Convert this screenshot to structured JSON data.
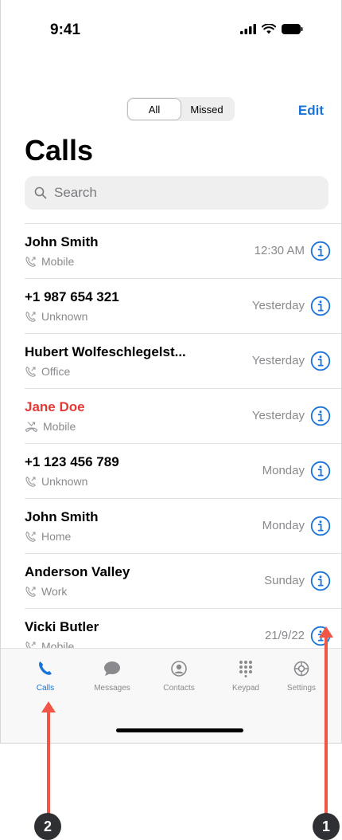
{
  "status_bar": {
    "time": "9:41"
  },
  "header": {
    "segments": [
      {
        "label": "All",
        "active": true
      },
      {
        "label": "Missed",
        "active": false
      }
    ],
    "edit_label": "Edit",
    "title": "Calls"
  },
  "search": {
    "placeholder": "Search"
  },
  "calls": [
    {
      "name": "John Smith",
      "type": "Mobile",
      "time": "12:30 AM",
      "missed": false,
      "icon": "phone-outgoing-icon"
    },
    {
      "name": "+1 987 654 321",
      "type": "Unknown",
      "time": "Yesterday",
      "missed": false,
      "icon": "phone-outgoing-icon"
    },
    {
      "name": "Hubert Wolfeschlegelst...",
      "type": "Office",
      "time": "Yesterday",
      "missed": false,
      "icon": "phone-outgoing-icon"
    },
    {
      "name": "Jane Doe",
      "type": "Mobile",
      "time": "Yesterday",
      "missed": true,
      "icon": "missed-call-icon"
    },
    {
      "name": "+1 123 456 789",
      "type": "Unknown",
      "time": "Monday",
      "missed": false,
      "icon": "phone-outgoing-icon"
    },
    {
      "name": "John Smith",
      "type": "Home",
      "time": "Monday",
      "missed": false,
      "icon": "phone-outgoing-icon"
    },
    {
      "name": "Anderson Valley",
      "type": "Work",
      "time": "Sunday",
      "missed": false,
      "icon": "phone-outgoing-icon"
    },
    {
      "name": "Vicki Butler",
      "type": "Mobile",
      "time": "21/9/22",
      "missed": false,
      "icon": "phone-outgoing-icon"
    }
  ],
  "tabs": [
    {
      "label": "Calls",
      "icon": "phone-icon",
      "active": true
    },
    {
      "label": "Messages",
      "icon": "chat-bubble-icon",
      "active": false
    },
    {
      "label": "Contacts",
      "icon": "person-circle-icon",
      "active": false
    },
    {
      "label": "Keypad",
      "icon": "keypad-icon",
      "active": false
    },
    {
      "label": "Settings",
      "icon": "gear-icon",
      "active": false
    }
  ],
  "annotations": [
    {
      "label": "1"
    },
    {
      "label": "2"
    }
  ],
  "colors": {
    "accent": "#1a73d9",
    "missed": "#e53935",
    "arrow": "#f05545",
    "secondary_text": "#8a8a8e"
  }
}
